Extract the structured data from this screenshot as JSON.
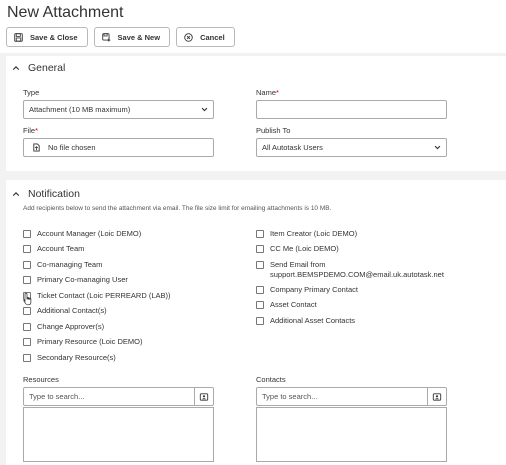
{
  "page": {
    "title": "New Attachment"
  },
  "toolbar": {
    "save_close": "Save & Close",
    "save_new": "Save & New",
    "cancel": "Cancel"
  },
  "general": {
    "title": "General",
    "type_label": "Type",
    "type_value": "Attachment (10 MB maximum)",
    "name_label": "Name",
    "name_value": "",
    "file_label": "File",
    "file_value": "No file chosen",
    "publish_label": "Publish To",
    "publish_value": "All Autotask Users",
    "required_mark": "*"
  },
  "notification": {
    "title": "Notification",
    "hint": "Add recipients below to send the attachment via email. The file size limit for emailing attachments is 10 MB.",
    "left_items": [
      "Account Manager (Loic DEMO)",
      "Account Team",
      "Co-managing Team",
      "Primary Co-managing User",
      "Ticket Contact (Loic PERREARD (LAB))",
      "Additional Contact(s)",
      "Change Approver(s)",
      "Primary Resource (Loic DEMO)",
      "Secondary Resource(s)"
    ],
    "right_items": [
      "Item Creator (Loic DEMO)",
      "CC Me (Loic DEMO)",
      "Send Email from",
      "support.BEMSPDEMO.COM@email.uk.autotask.net",
      "Company Primary Contact",
      "Asset Contact",
      "Additional Asset Contacts"
    ],
    "resources_label": "Resources",
    "contacts_label": "Contacts",
    "search_placeholder": "Type to search..."
  }
}
